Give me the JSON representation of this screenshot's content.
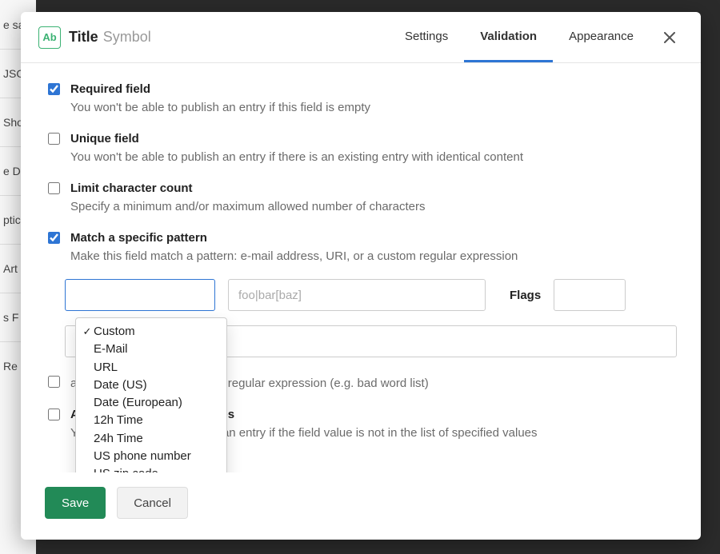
{
  "background_rows": [
    "e sa",
    "JSO",
    "Sho",
    "e D",
    "ptic",
    "Art",
    "s  F",
    "Re"
  ],
  "header": {
    "icon_text": "Ab",
    "title": "Title",
    "subtitle": "Symbol"
  },
  "tabs": {
    "settings": "Settings",
    "validation": "Validation",
    "appearance": "Appearance",
    "active": "validation"
  },
  "options": {
    "required": {
      "checked": true,
      "label": "Required field",
      "desc": "You won't be able to publish an entry if this field is empty"
    },
    "unique": {
      "checked": false,
      "label": "Unique field",
      "desc": "You won't be able to publish an entry if there is an existing entry with identical content"
    },
    "limit": {
      "checked": false,
      "label": "Limit character count",
      "desc": "Specify a minimum and/or maximum allowed number of characters"
    },
    "pattern": {
      "checked": true,
      "label": "Match a specific pattern",
      "desc": "Make this field match a pattern: e-mail address, URI, or a custom regular expression"
    },
    "prohibit": {
      "checked": false,
      "label_visible_fragment": "",
      "desc": "a pattern is matched: custom regular expression (e.g. bad word list)"
    },
    "accept": {
      "checked": false,
      "label": "Accept only specified values",
      "desc": "You won't be able to publish an entry if the field value is not in the list of specified values"
    }
  },
  "pattern_controls": {
    "regex_placeholder": "foo|bar[baz]",
    "flags_label": "Flags"
  },
  "dropdown": {
    "selected": "Custom",
    "items": [
      "Custom",
      "E-Mail",
      "URL",
      "Date (US)",
      "Date (European)",
      "12h Time",
      "24h Time",
      "US phone number",
      "US zip code"
    ]
  },
  "footer": {
    "save": "Save",
    "cancel": "Cancel"
  }
}
